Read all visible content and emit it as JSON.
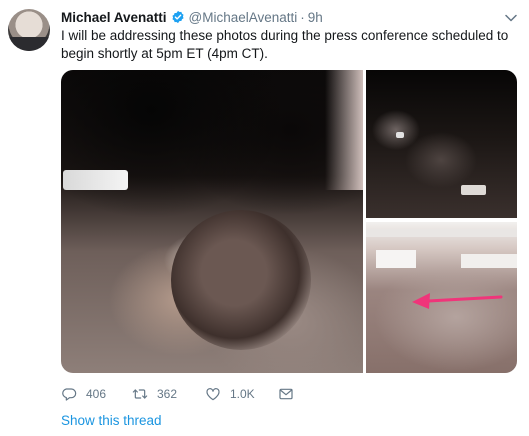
{
  "tweet": {
    "author_name": "Michael Avenatti",
    "handle": "@MichaelAvenatti",
    "separator": "·",
    "time": "9h",
    "text": "I will be addressing these photos during the press conference scheduled to begin shortly at 5pm ET (4pm CT).",
    "verified": true,
    "actions": {
      "reply_count": "406",
      "retweet_count": "362",
      "like_count": "1.0K"
    },
    "show_thread_label": "Show this thread"
  },
  "icons": {
    "verified": "verified-badge-icon",
    "caret": "chevron-down-icon",
    "reply": "reply-icon",
    "retweet": "retweet-icon",
    "like": "heart-icon",
    "dm": "envelope-icon",
    "arrow": "pink-arrow-annotation"
  },
  "colors": {
    "text": "#14171a",
    "muted": "#657786",
    "link": "#1b95e0",
    "verified": "#1da1f2",
    "annotation_arrow": "#f0357a"
  }
}
